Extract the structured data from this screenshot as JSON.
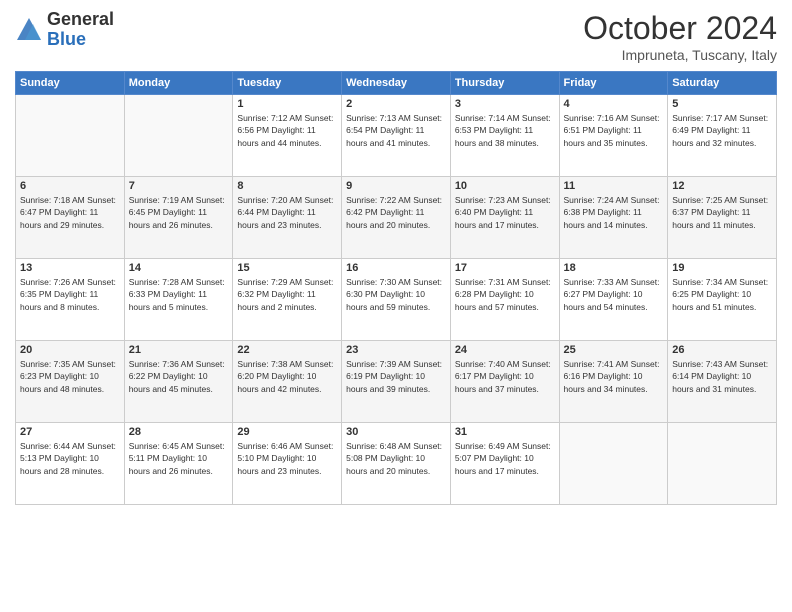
{
  "header": {
    "logo_general": "General",
    "logo_blue": "Blue",
    "month": "October 2024",
    "location": "Impruneta, Tuscany, Italy"
  },
  "days_of_week": [
    "Sunday",
    "Monday",
    "Tuesday",
    "Wednesday",
    "Thursday",
    "Friday",
    "Saturday"
  ],
  "weeks": [
    [
      {
        "day": "",
        "content": ""
      },
      {
        "day": "",
        "content": ""
      },
      {
        "day": "1",
        "content": "Sunrise: 7:12 AM\nSunset: 6:56 PM\nDaylight: 11 hours and 44 minutes."
      },
      {
        "day": "2",
        "content": "Sunrise: 7:13 AM\nSunset: 6:54 PM\nDaylight: 11 hours and 41 minutes."
      },
      {
        "day": "3",
        "content": "Sunrise: 7:14 AM\nSunset: 6:53 PM\nDaylight: 11 hours and 38 minutes."
      },
      {
        "day": "4",
        "content": "Sunrise: 7:16 AM\nSunset: 6:51 PM\nDaylight: 11 hours and 35 minutes."
      },
      {
        "day": "5",
        "content": "Sunrise: 7:17 AM\nSunset: 6:49 PM\nDaylight: 11 hours and 32 minutes."
      }
    ],
    [
      {
        "day": "6",
        "content": "Sunrise: 7:18 AM\nSunset: 6:47 PM\nDaylight: 11 hours and 29 minutes."
      },
      {
        "day": "7",
        "content": "Sunrise: 7:19 AM\nSunset: 6:45 PM\nDaylight: 11 hours and 26 minutes."
      },
      {
        "day": "8",
        "content": "Sunrise: 7:20 AM\nSunset: 6:44 PM\nDaylight: 11 hours and 23 minutes."
      },
      {
        "day": "9",
        "content": "Sunrise: 7:22 AM\nSunset: 6:42 PM\nDaylight: 11 hours and 20 minutes."
      },
      {
        "day": "10",
        "content": "Sunrise: 7:23 AM\nSunset: 6:40 PM\nDaylight: 11 hours and 17 minutes."
      },
      {
        "day": "11",
        "content": "Sunrise: 7:24 AM\nSunset: 6:38 PM\nDaylight: 11 hours and 14 minutes."
      },
      {
        "day": "12",
        "content": "Sunrise: 7:25 AM\nSunset: 6:37 PM\nDaylight: 11 hours and 11 minutes."
      }
    ],
    [
      {
        "day": "13",
        "content": "Sunrise: 7:26 AM\nSunset: 6:35 PM\nDaylight: 11 hours and 8 minutes."
      },
      {
        "day": "14",
        "content": "Sunrise: 7:28 AM\nSunset: 6:33 PM\nDaylight: 11 hours and 5 minutes."
      },
      {
        "day": "15",
        "content": "Sunrise: 7:29 AM\nSunset: 6:32 PM\nDaylight: 11 hours and 2 minutes."
      },
      {
        "day": "16",
        "content": "Sunrise: 7:30 AM\nSunset: 6:30 PM\nDaylight: 10 hours and 59 minutes."
      },
      {
        "day": "17",
        "content": "Sunrise: 7:31 AM\nSunset: 6:28 PM\nDaylight: 10 hours and 57 minutes."
      },
      {
        "day": "18",
        "content": "Sunrise: 7:33 AM\nSunset: 6:27 PM\nDaylight: 10 hours and 54 minutes."
      },
      {
        "day": "19",
        "content": "Sunrise: 7:34 AM\nSunset: 6:25 PM\nDaylight: 10 hours and 51 minutes."
      }
    ],
    [
      {
        "day": "20",
        "content": "Sunrise: 7:35 AM\nSunset: 6:23 PM\nDaylight: 10 hours and 48 minutes."
      },
      {
        "day": "21",
        "content": "Sunrise: 7:36 AM\nSunset: 6:22 PM\nDaylight: 10 hours and 45 minutes."
      },
      {
        "day": "22",
        "content": "Sunrise: 7:38 AM\nSunset: 6:20 PM\nDaylight: 10 hours and 42 minutes."
      },
      {
        "day": "23",
        "content": "Sunrise: 7:39 AM\nSunset: 6:19 PM\nDaylight: 10 hours and 39 minutes."
      },
      {
        "day": "24",
        "content": "Sunrise: 7:40 AM\nSunset: 6:17 PM\nDaylight: 10 hours and 37 minutes."
      },
      {
        "day": "25",
        "content": "Sunrise: 7:41 AM\nSunset: 6:16 PM\nDaylight: 10 hours and 34 minutes."
      },
      {
        "day": "26",
        "content": "Sunrise: 7:43 AM\nSunset: 6:14 PM\nDaylight: 10 hours and 31 minutes."
      }
    ],
    [
      {
        "day": "27",
        "content": "Sunrise: 6:44 AM\nSunset: 5:13 PM\nDaylight: 10 hours and 28 minutes."
      },
      {
        "day": "28",
        "content": "Sunrise: 6:45 AM\nSunset: 5:11 PM\nDaylight: 10 hours and 26 minutes."
      },
      {
        "day": "29",
        "content": "Sunrise: 6:46 AM\nSunset: 5:10 PM\nDaylight: 10 hours and 23 minutes."
      },
      {
        "day": "30",
        "content": "Sunrise: 6:48 AM\nSunset: 5:08 PM\nDaylight: 10 hours and 20 minutes."
      },
      {
        "day": "31",
        "content": "Sunrise: 6:49 AM\nSunset: 5:07 PM\nDaylight: 10 hours and 17 minutes."
      },
      {
        "day": "",
        "content": ""
      },
      {
        "day": "",
        "content": ""
      }
    ]
  ]
}
